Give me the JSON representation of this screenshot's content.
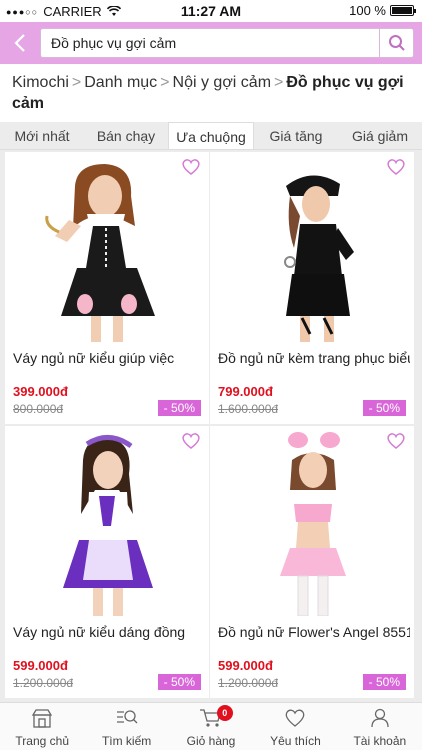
{
  "status_bar": {
    "carrier": "CARRIER",
    "time": "11:27 AM",
    "battery": "100 %"
  },
  "search": {
    "value": "Đồ phục vụ gợi cảm"
  },
  "breadcrumb": {
    "items": [
      "Kimochi",
      "Danh mục",
      "Nội y gợi cảm"
    ],
    "current": "Đồ phục vụ gợi cảm"
  },
  "tabs": [
    "Mới nhất",
    "Bán chạy",
    "Ưa chuộng",
    "Giá tăng",
    "Giá giảm"
  ],
  "active_tab": "Ưa chuộng",
  "products": [
    {
      "name": "Váy ngủ nữ kiểu giúp việc",
      "price": "399.000đ",
      "old_price": "800.000đ",
      "discount": "- 50%"
    },
    {
      "name": "Đồ ngủ nữ kèm trang phục biểu",
      "price": "799.000đ",
      "old_price": "1.600.000đ",
      "discount": "- 50%"
    },
    {
      "name": "Váy ngủ nữ kiểu dáng đồng",
      "price": "599.000đ",
      "old_price": "1.200.000đ",
      "discount": "- 50%"
    },
    {
      "name": "Đồ ngủ nữ Flower's Angel 8551",
      "price": "599.000đ",
      "old_price": "1.200.000đ",
      "discount": "- 50%"
    }
  ],
  "bottom_nav": [
    {
      "label": "Trang chủ",
      "icon": "shop-icon"
    },
    {
      "label": "Tìm kiếm",
      "icon": "search-list-icon"
    },
    {
      "label": "Giỏ hàng",
      "icon": "cart-icon",
      "badge": "0"
    },
    {
      "label": "Yêu thích",
      "icon": "heart-icon"
    },
    {
      "label": "Tài khoản",
      "icon": "user-icon"
    }
  ],
  "colors": {
    "accent": "#e6a6e6",
    "discount": "#d966d9",
    "price": "#e0101e"
  }
}
